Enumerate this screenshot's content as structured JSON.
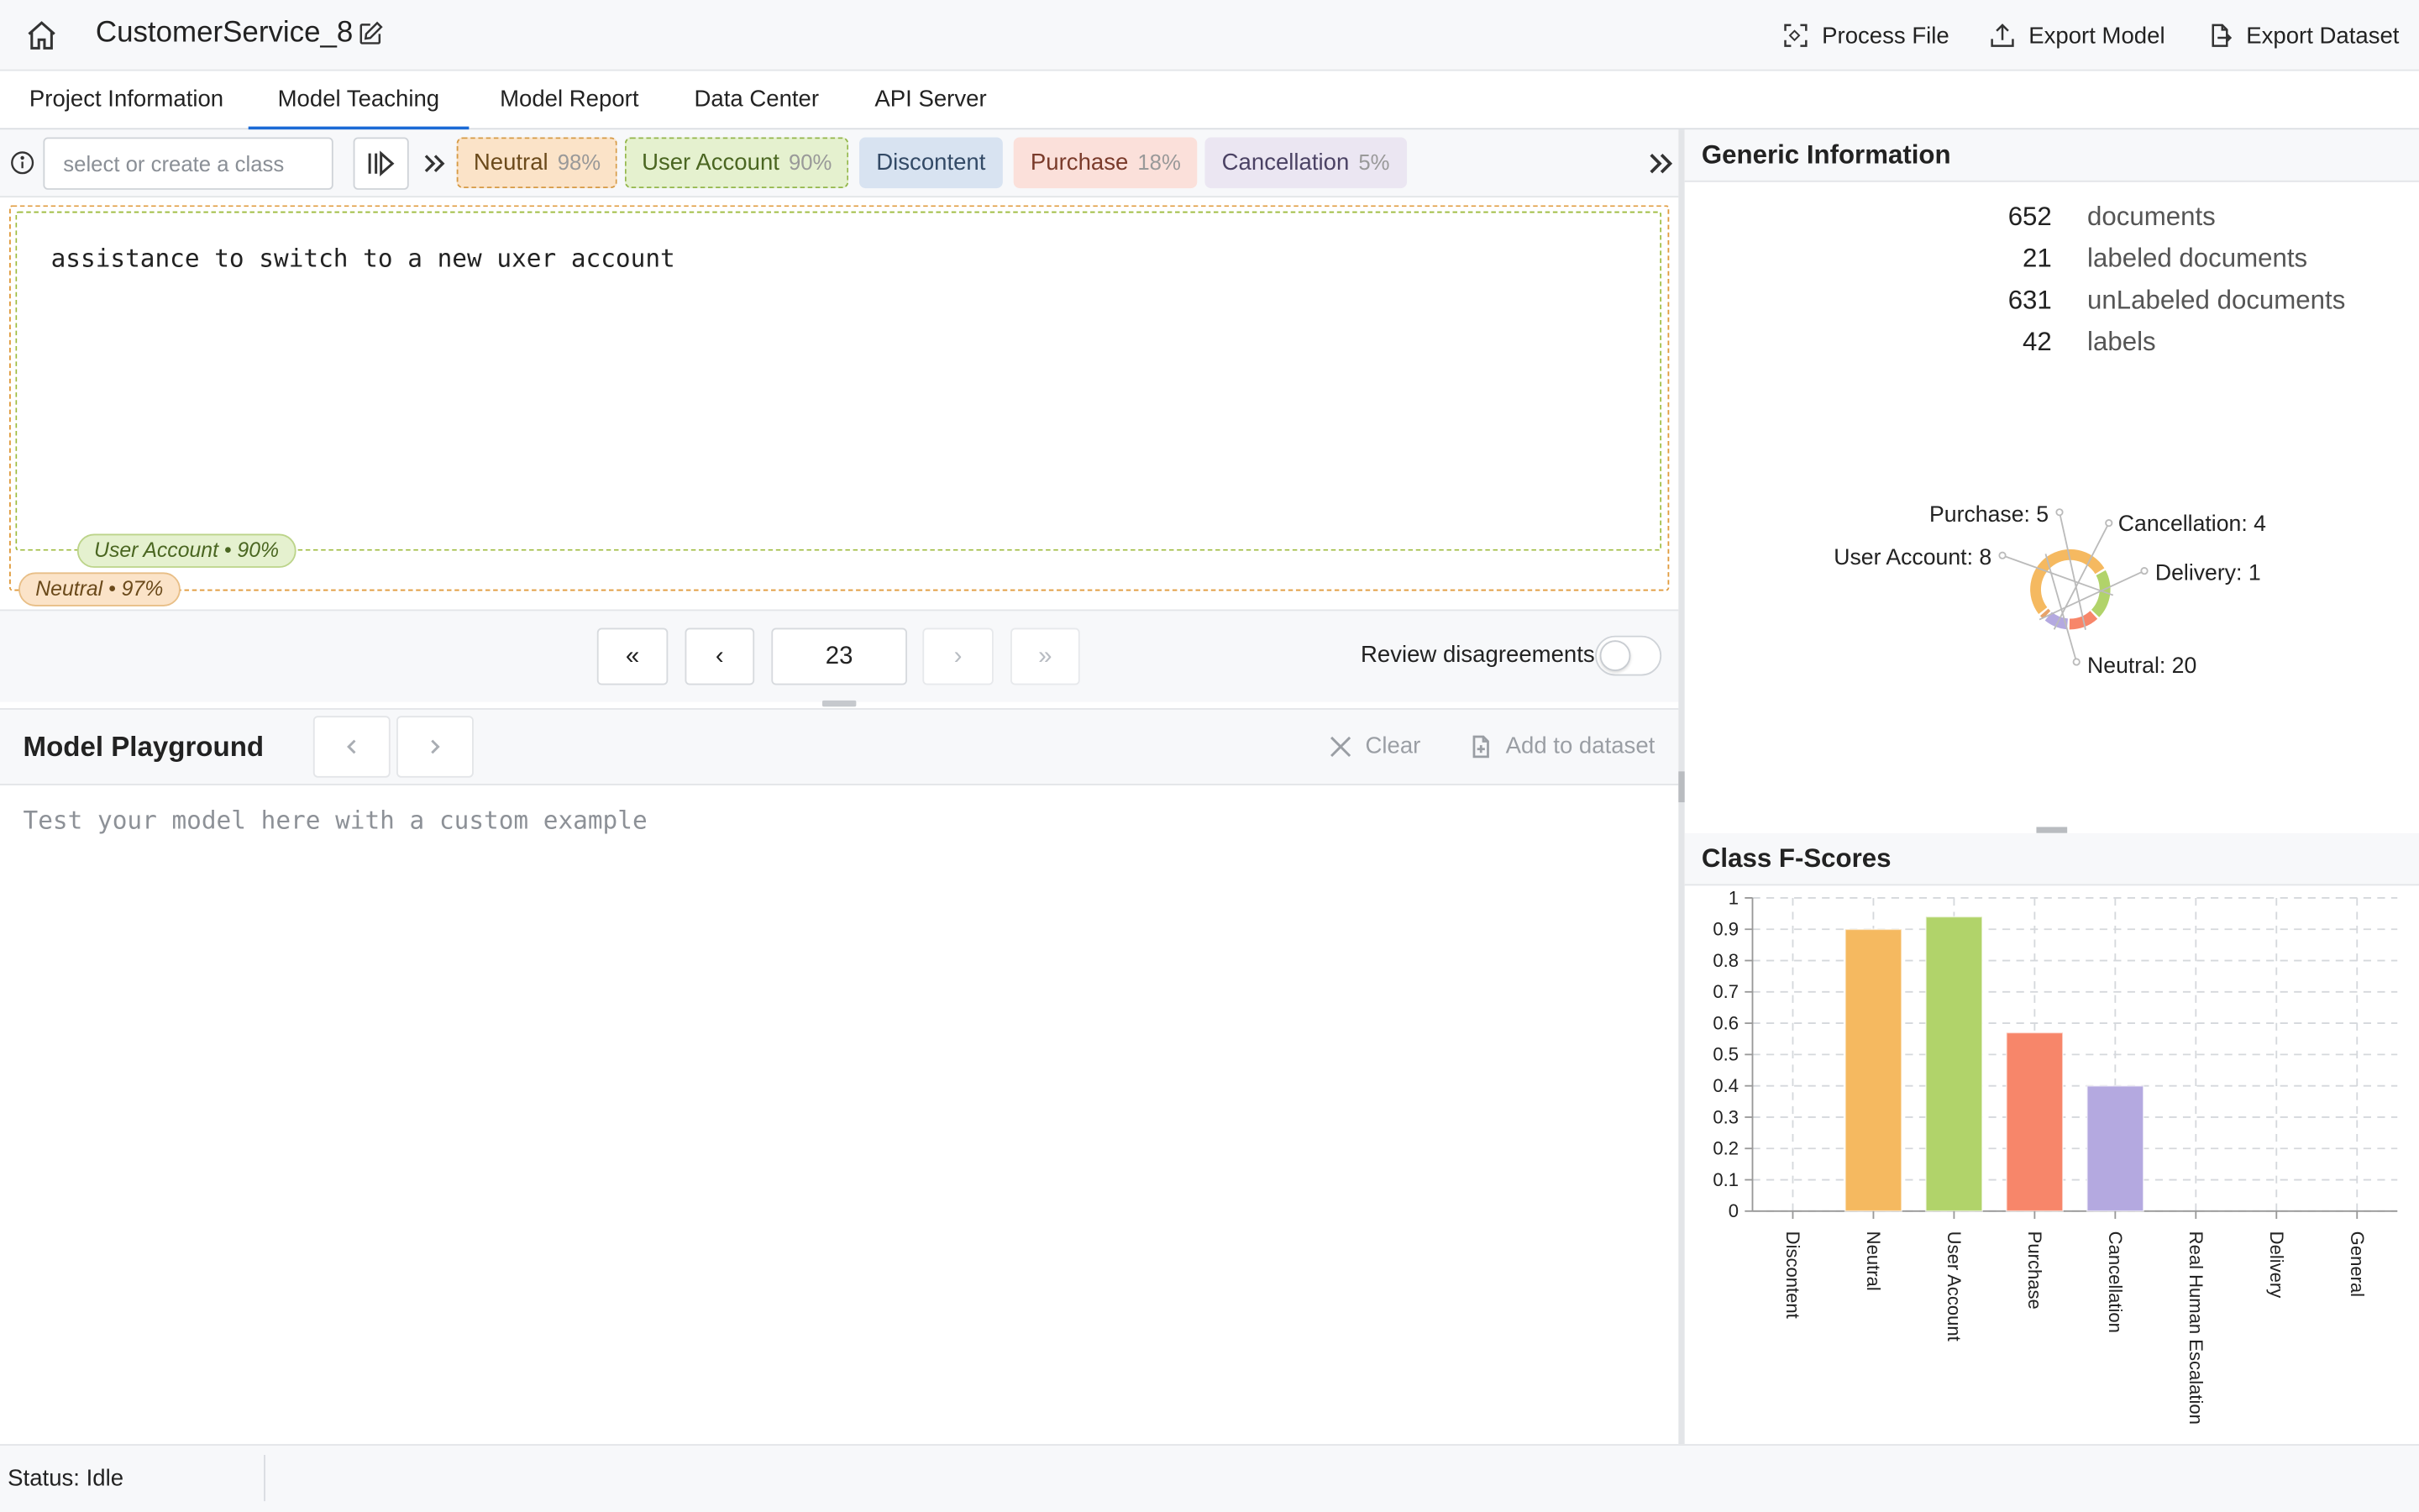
{
  "header": {
    "title": "CustomerService_8",
    "actions": [
      {
        "label": "Process File",
        "icon": "scan-icon"
      },
      {
        "label": "Export Model",
        "icon": "upload-icon"
      },
      {
        "label": "Export Dataset",
        "icon": "file-export-icon"
      }
    ]
  },
  "tabs": [
    {
      "label": "Project Information",
      "active": false
    },
    {
      "label": "Model Teaching",
      "active": true
    },
    {
      "label": "Model Report",
      "active": false
    },
    {
      "label": "Data Center",
      "active": false
    },
    {
      "label": "API Server",
      "active": false
    }
  ],
  "toolbar": {
    "class_placeholder": "select or create a class",
    "chips": [
      {
        "label": "Neutral",
        "pct": "98%"
      },
      {
        "label": "User Account",
        "pct": "90%"
      },
      {
        "label": "Discontent",
        "pct": ""
      },
      {
        "label": "Purchase",
        "pct": "18%"
      },
      {
        "label": "Cancellation",
        "pct": "5%"
      }
    ]
  },
  "document": {
    "text": "assistance to switch to a new uxer account",
    "labels": [
      {
        "text": "User Account • 90%"
      },
      {
        "text": "Neutral • 97%"
      }
    ]
  },
  "pager": {
    "first": "«",
    "prev": "‹",
    "current": "23",
    "next": "›",
    "last": "»",
    "review_label": "Review disagreements",
    "review_on": false
  },
  "playground": {
    "title": "Model Playground",
    "clear_label": "Clear",
    "add_label": "Add to dataset",
    "placeholder": "Test your model here with a custom example"
  },
  "generic_info": {
    "title": "Generic Information",
    "stats": [
      {
        "value": "652",
        "label": "documents"
      },
      {
        "value": "21",
        "label": "labeled documents"
      },
      {
        "value": "631",
        "label": "unLabeled documents"
      },
      {
        "value": "42",
        "label": "labels"
      }
    ],
    "donut_labels": [
      "Purchase: 5",
      "Cancellation: 4",
      "User Account: 8",
      "Delivery: 1",
      "Neutral: 20"
    ]
  },
  "colors": {
    "neutral": "#f5b960",
    "user_account": "#b1d36a",
    "purchase": "#f7866a",
    "cancellation": "#b4a9e0",
    "delivery": "#e7a36a",
    "accent": "#1b6ad6"
  },
  "chart_data": [
    {
      "type": "pie",
      "title": "",
      "categories": [
        "Neutral",
        "User Account",
        "Purchase",
        "Cancellation",
        "Delivery"
      ],
      "values": [
        20,
        8,
        5,
        4,
        1
      ]
    },
    {
      "type": "bar",
      "title": "Class F-Scores",
      "categories": [
        "Discontent",
        "Neutral",
        "User Account",
        "Purchase",
        "Cancellation",
        "Real Human Escalation",
        "Delivery",
        "General"
      ],
      "values": [
        0,
        0.9,
        0.94,
        0.57,
        0.4,
        0,
        0,
        0
      ],
      "ylim": [
        0,
        1
      ],
      "yticks": [
        "0",
        "0.1",
        "0.2",
        "0.3",
        "0.4",
        "0.5",
        "0.6",
        "0.7",
        "0.8",
        "0.9",
        "1"
      ],
      "grid": true
    }
  ],
  "status": {
    "text": "Status:  Idle"
  }
}
